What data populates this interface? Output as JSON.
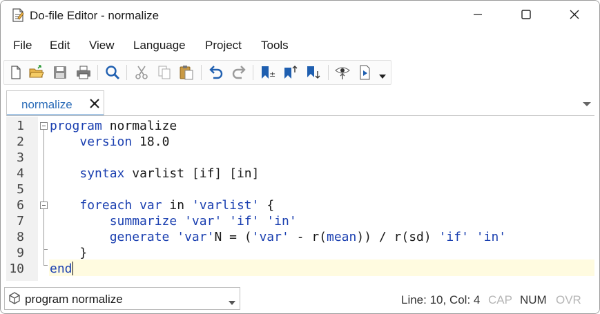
{
  "window": {
    "title": "Do-file Editor - normalize",
    "icons": {
      "app": "document-icon",
      "minimize": "minimize-icon",
      "maximize": "maximize-icon",
      "close": "close-icon"
    }
  },
  "menu": {
    "items": [
      "File",
      "Edit",
      "View",
      "Language",
      "Project",
      "Tools"
    ]
  },
  "toolbar": {
    "buttons": [
      {
        "name": "new-file-button",
        "icon": "new-document-icon"
      },
      {
        "name": "open-file-button",
        "icon": "open-folder-icon"
      },
      {
        "name": "save-button",
        "icon": "floppy-disk-icon"
      },
      {
        "name": "print-button",
        "icon": "printer-icon"
      },
      {
        "name": "find-button",
        "icon": "magnifier-icon"
      },
      {
        "name": "cut-button",
        "icon": "scissors-icon"
      },
      {
        "name": "copy-button",
        "icon": "copy-icon"
      },
      {
        "name": "paste-button",
        "icon": "clipboard-icon"
      },
      {
        "name": "undo-button",
        "icon": "undo-arrow-icon"
      },
      {
        "name": "redo-button",
        "icon": "redo-arrow-icon"
      },
      {
        "name": "toggle-bookmark-button",
        "icon": "bookmark-toggle-icon"
      },
      {
        "name": "previous-bookmark-button",
        "icon": "bookmark-up-icon"
      },
      {
        "name": "next-bookmark-button",
        "icon": "bookmark-down-icon"
      },
      {
        "name": "show-file-in-viewer-button",
        "icon": "eye-icon"
      },
      {
        "name": "execute-do-button",
        "icon": "run-document-icon"
      }
    ]
  },
  "tabs": [
    {
      "label": "normalize",
      "active": true
    }
  ],
  "editor": {
    "line_numbers": [
      "1",
      "2",
      "3",
      "4",
      "5",
      "6",
      "7",
      "8",
      "9",
      "10"
    ],
    "current_line": 10,
    "lines": {
      "l1": {
        "kw": "program",
        "rest": " normalize"
      },
      "l2": {
        "indent": "    ",
        "kw": "version",
        "rest": " 18.0"
      },
      "l4": {
        "indent": "    ",
        "kw": "syntax",
        "rest": " varlist [if] [in]"
      },
      "l6": {
        "indent": "    ",
        "kw1": "foreach",
        "sp1": " ",
        "kw2": "var",
        "mid": " in ",
        "str1": "'varlist'",
        "rest": " {"
      },
      "l7": {
        "indent": "        ",
        "kw": "summarize",
        "sp": " ",
        "s1": "'var'",
        "s2": "'if'",
        "s3": "'in'"
      },
      "l8": {
        "indent": "        ",
        "kw": "generate",
        "sp": " ",
        "s1": "'var'",
        "mid1": "N = (",
        "s2": "'var'",
        "mid2": " - r(",
        "kw2": "mean",
        "mid3": ")) / r(sd) ",
        "s3": "'if'",
        "s4": "'in'"
      },
      "l9": {
        "indent": "    ",
        "rest": "}"
      },
      "l10": {
        "kw": "end"
      }
    }
  },
  "statusbar": {
    "navigator": {
      "label": "program normalize",
      "icon": "cube-icon"
    },
    "position": "Line: 10, Col: 4",
    "indicators": {
      "cap": "CAP",
      "num": "NUM",
      "ovr": "OVR"
    }
  }
}
